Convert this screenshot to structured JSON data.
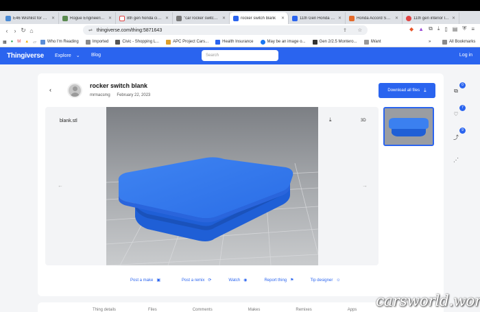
{
  "browser": {
    "tabs": [
      {
        "label": "E46 Wishlist for Highl...",
        "color": "#4a8ad4",
        "icon": "doc-icon"
      },
      {
        "label": "Rogue Engineering O...",
        "color": "#5a8a50",
        "icon": "site-icon"
      },
      {
        "label": "8th gen honda civic c...",
        "color": "#e04343",
        "icon": "google-icon"
      },
      {
        "label": "\"car rocker switch bla...",
        "color": "#777",
        "icon": "site-icon"
      },
      {
        "label": "rocker switch blank",
        "color": "#2a64ef",
        "icon": "thingiverse-icon",
        "active": true
      },
      {
        "label": "11th Gen Honda Civic...",
        "color": "#2a64ef",
        "icon": "thingiverse-icon"
      },
      {
        "label": "Honda Accord Switc...",
        "color": "#e46a2a",
        "icon": "site-icon"
      },
      {
        "label": "11th gen interior la sc...",
        "color": "#e04343",
        "icon": "site-icon"
      }
    ],
    "url": "thingiverse.com/thing:5871643",
    "bookmarks": [
      {
        "label": "Who I'm Reading",
        "color": "#5a8dd6"
      },
      {
        "label": "Imported",
        "color": "#8a8a8a"
      },
      {
        "label": "Civic - Shopping L...",
        "color": "#555"
      },
      {
        "label": "APC Project Cars...",
        "color": "#e0a02a"
      },
      {
        "label": "Health Insurance",
        "color": "#2a64ef"
      },
      {
        "label": "May be an image o...",
        "color": "#1877f2"
      },
      {
        "label": "Gen 2/2.5 Montero...",
        "color": "#333"
      },
      {
        "label": "iWant",
        "color": "#999"
      }
    ],
    "all_bookmarks": "All Bookmarks"
  },
  "site": {
    "logo": "Thingiverse",
    "explore": "Explore",
    "blog": "Blog",
    "search_placeholder": "Search",
    "login": "Log in"
  },
  "thing": {
    "title": "rocker switch blank",
    "author": "mrmacsmg",
    "date": "February 22, 2023",
    "download_label": "Download all files",
    "filename": "blank.stl",
    "view_3d": "3D"
  },
  "actions": [
    {
      "label": "Post a make",
      "icon": "make-icon"
    },
    {
      "label": "Post a remix",
      "icon": "remix-icon"
    },
    {
      "label": "Watch",
      "icon": "eye-icon"
    },
    {
      "label": "Report thing",
      "icon": "flag-icon"
    },
    {
      "label": "Tip designer",
      "icon": "smile-icon"
    }
  ],
  "sidebar": {
    "collect_count": "0",
    "like_count": "7",
    "remix_count": "9"
  },
  "bottom_tabs": [
    "Thing details",
    "Files",
    "Comments",
    "Makes",
    "Remixes",
    "Apps"
  ],
  "watermark": "carsworld.world",
  "colors": {
    "accent": "#2a64ef",
    "model": "#2f6fe0"
  }
}
